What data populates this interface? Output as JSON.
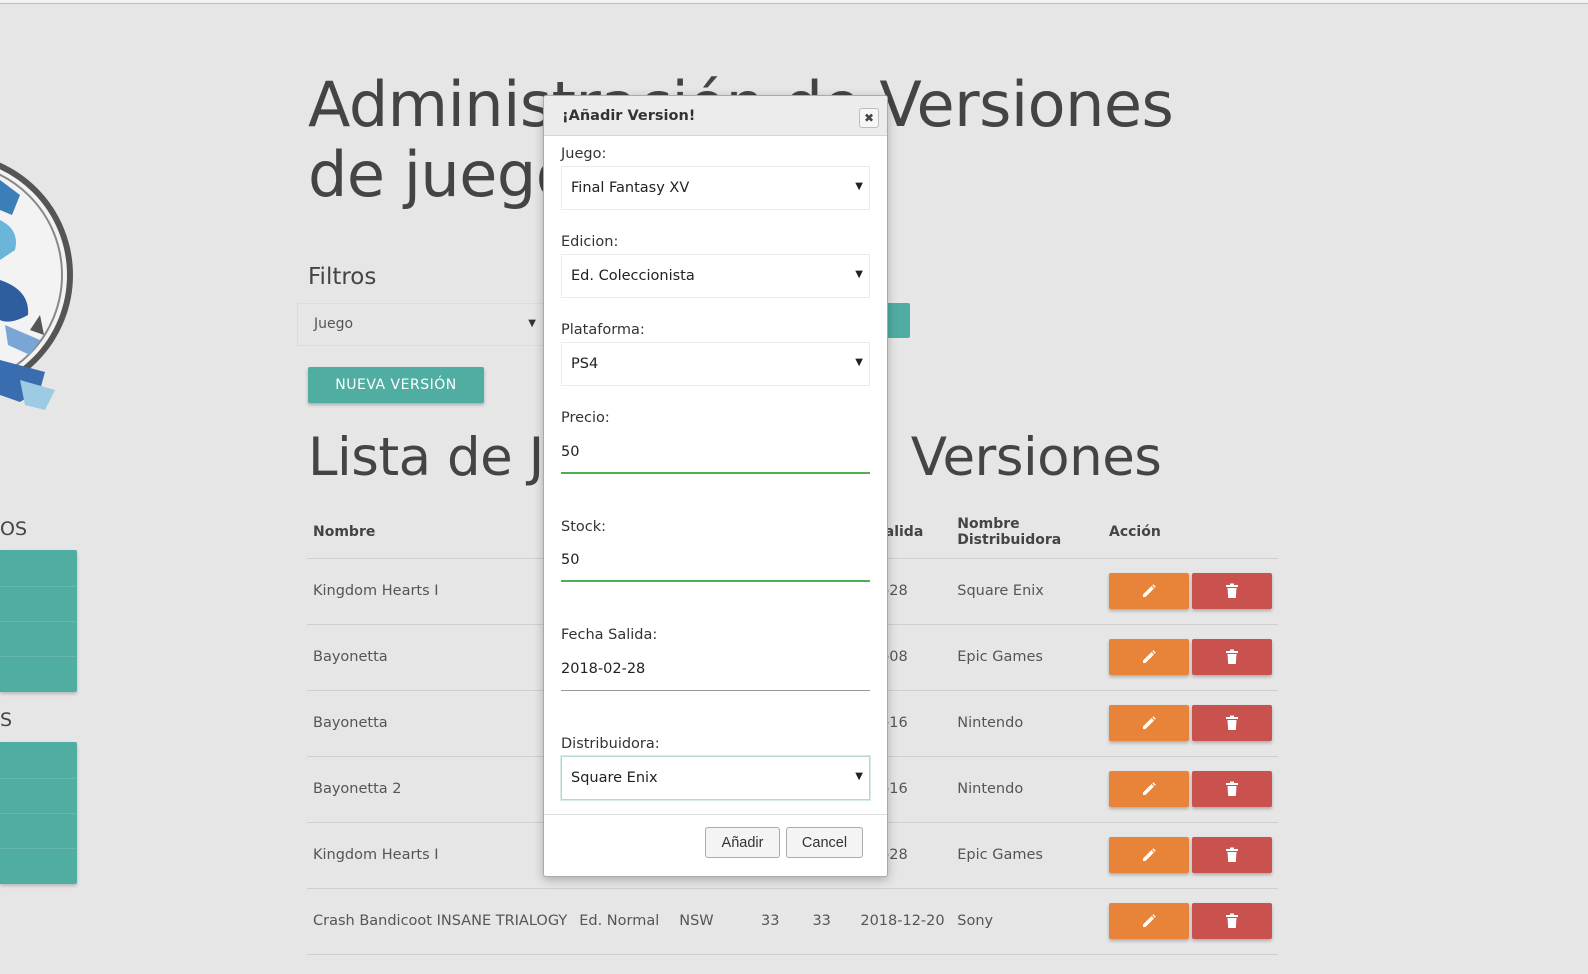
{
  "page": {
    "title": "Administración de Versiones de juegos",
    "filters_label": "Filtros",
    "filter_select_value": "Juego",
    "new_version_button": "NUEVA VERSIÓN",
    "list_title_left": "Lista de Ju",
    "list_title_right": "Versiones"
  },
  "sidebar": {
    "heading_1": "OS",
    "heading_2": "S"
  },
  "table": {
    "headers": [
      "Nombre",
      "",
      "",
      "",
      "",
      "a Salida",
      "Nombre Distribuidora",
      "Acción"
    ],
    "rows": [
      {
        "nombre": "Kingdom Hearts I",
        "edicion": "",
        "plataforma": "",
        "precio": "",
        "stock": "",
        "fecha": "-02-28",
        "distribuidora": "Square Enix"
      },
      {
        "nombre": "Bayonetta",
        "edicion": "",
        "plataforma": "",
        "precio": "",
        "stock": "",
        "fecha": "-02-08",
        "distribuidora": "Epic Games"
      },
      {
        "nombre": "Bayonetta",
        "edicion": "",
        "plataforma": "",
        "precio": "",
        "stock": "",
        "fecha": "-02-16",
        "distribuidora": "Nintendo"
      },
      {
        "nombre": "Bayonetta 2",
        "edicion": "",
        "plataforma": "",
        "precio": "",
        "stock": "",
        "fecha": "-02-16",
        "distribuidora": "Nintendo"
      },
      {
        "nombre": "Kingdom Hearts I",
        "edicion": "",
        "plataforma": "",
        "precio": "",
        "stock": "",
        "fecha": "-02-28",
        "distribuidora": "Epic Games"
      },
      {
        "nombre": "Crash Bandicoot INSANE TRIALOGY",
        "edicion": "Ed. Normal",
        "plataforma": "NSW",
        "precio": "33",
        "stock": "33",
        "fecha": "2018-12-20",
        "distribuidora": "Sony"
      }
    ]
  },
  "icons": {
    "edit": "pencil-icon",
    "delete": "trash-icon",
    "close": "close-icon",
    "dropdown": "caret-down-icon"
  },
  "modal": {
    "title": "¡Añadir Version!",
    "close_glyph": "✖",
    "juego_label": "Juego:",
    "juego_value": "Final Fantasy XV",
    "edicion_label": "Edicion:",
    "edicion_value": "Ed. Coleccionista",
    "plataforma_label": "Plataforma:",
    "plataforma_value": "PS4",
    "precio_label": "Precio:",
    "precio_value": "50",
    "stock_label": "Stock:",
    "stock_value": "50",
    "fecha_label": "Fecha Salida:",
    "fecha_value": "2018-02-28",
    "distribuidora_label": "Distribuidora:",
    "distribuidora_value": "Square Enix",
    "add_button": "Añadir",
    "cancel_button": "Cancel"
  },
  "colors": {
    "teal": "#4fada2",
    "orange": "#e8833a",
    "red": "#c9524f",
    "valid_green": "#4caf50"
  }
}
